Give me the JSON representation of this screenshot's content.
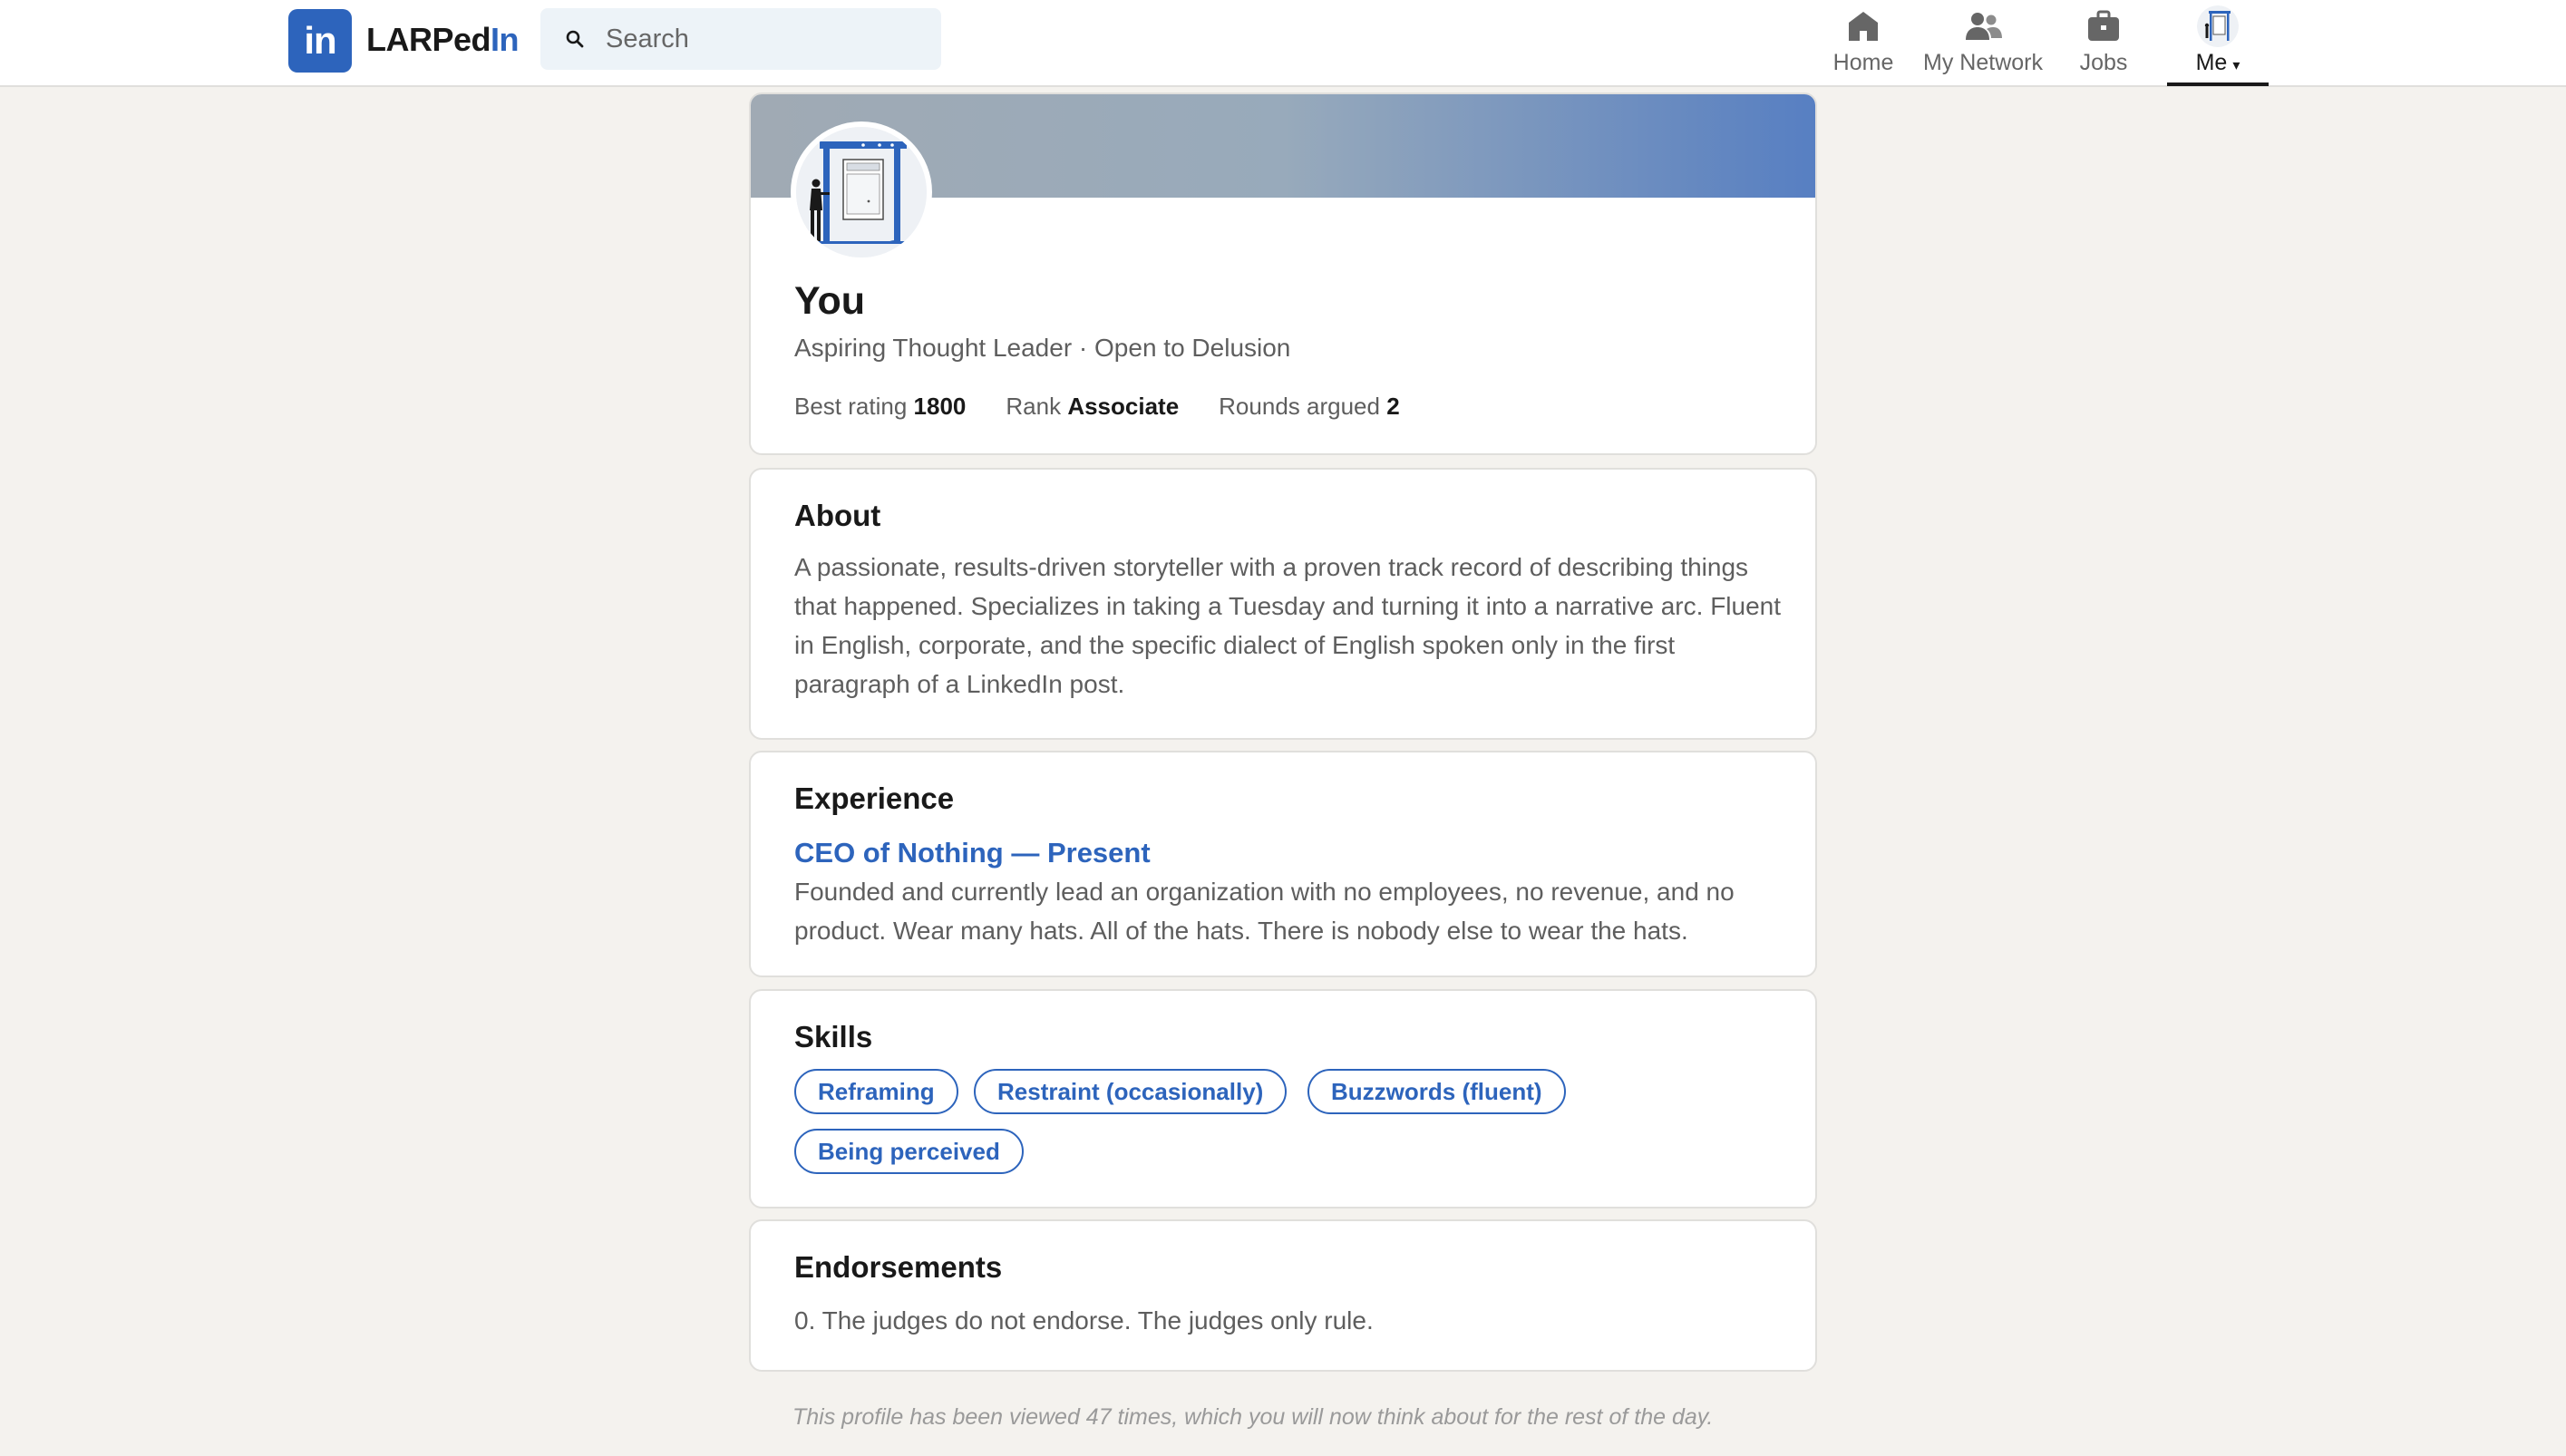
{
  "nav": {
    "logo_text": "in",
    "brand_main": "LARPed",
    "brand_accent": "In",
    "search_placeholder": "Search",
    "items": [
      {
        "label": "Home",
        "icon": "home-icon"
      },
      {
        "label": "My Network",
        "icon": "people-icon"
      },
      {
        "label": "Jobs",
        "icon": "briefcase-icon"
      },
      {
        "label": "Me",
        "icon": "avatar-icon",
        "active": true
      }
    ],
    "me_caret": "▾"
  },
  "profile": {
    "name": "You",
    "headline": "Aspiring Thought Leader · Open to Delusion",
    "stats": [
      {
        "label": "Best rating",
        "value": "1800"
      },
      {
        "label": "Rank",
        "value": "Associate"
      },
      {
        "label": "Rounds argued",
        "value": "2"
      }
    ]
  },
  "about": {
    "title": "About",
    "text": "A passionate, results-driven storyteller with a proven track record of describing things that happened. Specializes in taking a Tuesday and turning it into a narrative arc. Fluent in English, corporate, and the specific dialect of English spoken only in the first paragraph of a LinkedIn post."
  },
  "experience": {
    "title": "Experience",
    "role": "CEO of Nothing — Present",
    "description": "Founded and currently lead an organization with no employees, no revenue, and no product. Wear many hats. All of the hats. There is nobody else to wear the hats."
  },
  "skills": {
    "title": "Skills",
    "items": [
      "Reframing",
      "Restraint (occasionally)",
      "Buzzwords (fluent)",
      "Being perceived"
    ]
  },
  "endorsements": {
    "title": "Endorsements",
    "text": "0. The judges do not endorse. The judges only rule."
  },
  "footer_note": "This profile has been viewed 47 times, which you will now think about for the rest of the day.",
  "colors": {
    "accent": "#2d64bc",
    "background": "#f4f2ee",
    "muted_text": "#5e5e5e"
  }
}
